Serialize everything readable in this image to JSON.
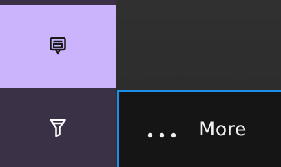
{
  "sidebar": {
    "items": [
      {
        "icon": "popup-icon",
        "active": true
      },
      {
        "icon": "filter-icon",
        "active": false
      }
    ]
  },
  "more_button": {
    "icon": "ellipsis-icon",
    "label": "More"
  },
  "colors": {
    "active_item_bg": "#cbb4fb",
    "sidebar_bg": "#3a3146",
    "more_button_bg": "#151515",
    "focus_border": "#1e8fe6"
  }
}
